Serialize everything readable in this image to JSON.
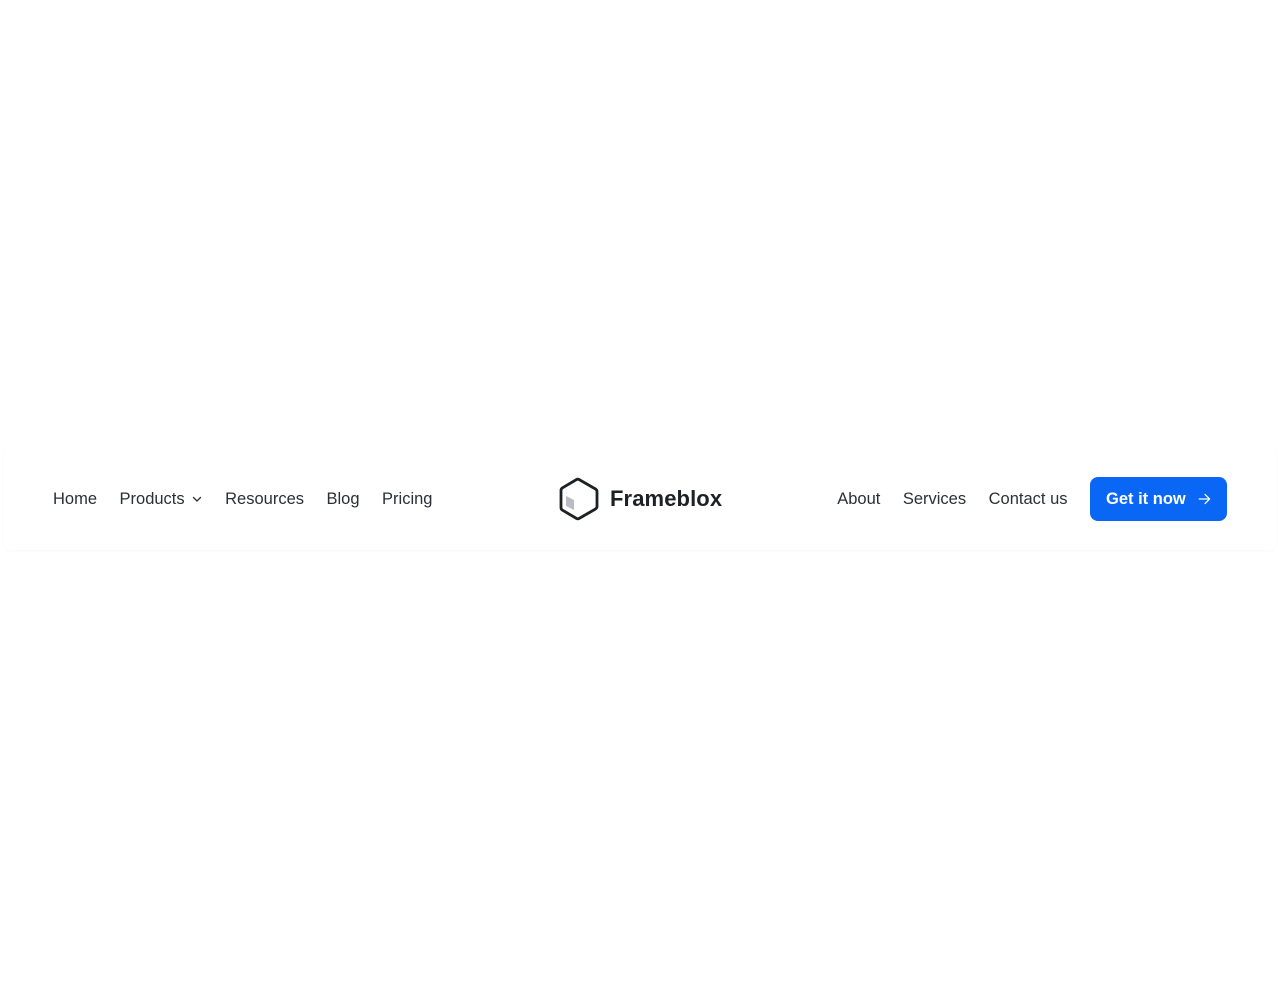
{
  "navbar": {
    "left_links": [
      {
        "label": "Home",
        "has_dropdown": false
      },
      {
        "label": "Products",
        "has_dropdown": true
      },
      {
        "label": "Resources",
        "has_dropdown": false
      },
      {
        "label": "Blog",
        "has_dropdown": false
      },
      {
        "label": "Pricing",
        "has_dropdown": false
      }
    ],
    "brand": {
      "name": "Frameblox",
      "logo_icon": "hexagon-cube-icon"
    },
    "right_links": [
      {
        "label": "About"
      },
      {
        "label": "Services"
      },
      {
        "label": "Contact us"
      }
    ],
    "cta": {
      "label": "Get it now",
      "icon": "arrow-right-icon",
      "color": "#0a66f5"
    }
  }
}
